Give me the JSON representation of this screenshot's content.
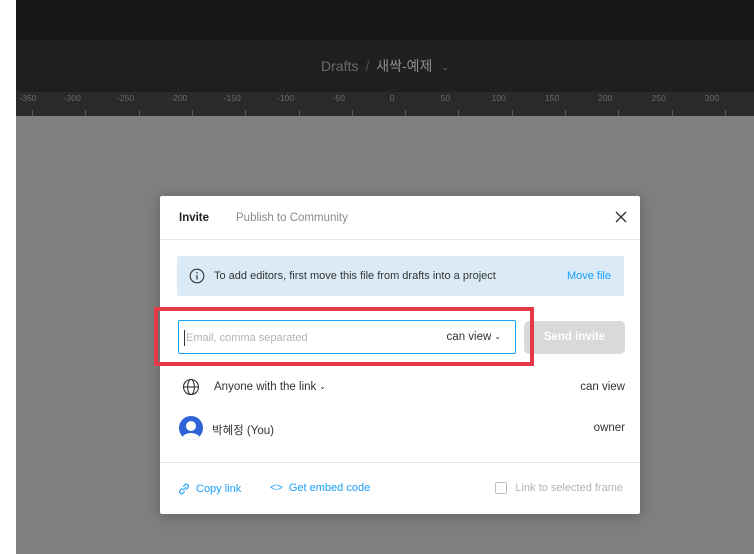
{
  "header": {
    "breadcrumb_root": "Drafts",
    "separator": "/",
    "file_name": "새싹-예제"
  },
  "ruler": {
    "ticks": [
      "-350",
      "-300",
      "-250",
      "-200",
      "-150",
      "-100",
      "-50",
      "0",
      "50",
      "100",
      "150",
      "200",
      "250",
      "300"
    ]
  },
  "modal": {
    "tabs": {
      "invite": "Invite",
      "publish": "Publish to Community"
    },
    "banner": {
      "text": "To add editors, first move this file from drafts into a project",
      "action": "Move file",
      "icon": "info-icon"
    },
    "invite_form": {
      "email_placeholder": "Email, comma separated",
      "email_value": "",
      "permission": "can view",
      "send_label": "Send invite"
    },
    "link_access": {
      "label": "Anyone with the link",
      "permission": "can view",
      "icon": "globe-icon"
    },
    "members": [
      {
        "name": "박혜정 (You)",
        "role": "owner"
      }
    ],
    "footer": {
      "copy_link": "Copy link",
      "embed_code": "Get embed code",
      "link_to_frame": "Link to selected frame",
      "link_to_frame_checked": false
    }
  },
  "colors": {
    "accent": "#18a0fb",
    "banner_bg": "#daebf7",
    "highlight": "#e63946",
    "avatar": "#2f63d8",
    "disabled_button": "#d9d9d9"
  }
}
